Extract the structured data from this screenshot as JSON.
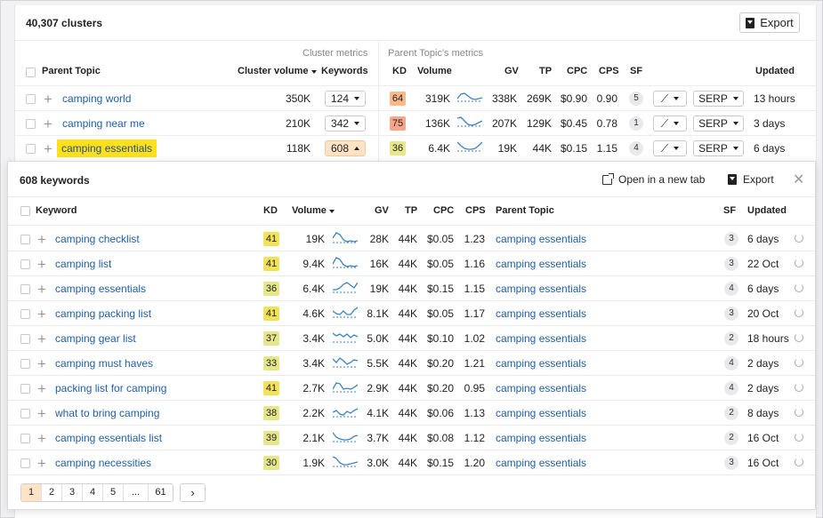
{
  "clusters_title": "40,307 clusters",
  "export_label": "Export",
  "cluster_metrics_label": "Cluster metrics",
  "parent_metrics_label": "Parent Topic's metrics",
  "outer_headers": {
    "parent_topic": "Parent Topic",
    "cluster_volume": "Cluster volume",
    "keywords": "Keywords",
    "kd": "KD",
    "volume": "Volume",
    "gv": "GV",
    "tp": "TP",
    "cpc": "CPC",
    "cps": "CPS",
    "sf": "SF",
    "updated": "Updated"
  },
  "clusters": [
    {
      "topic": "camping world",
      "cluster_volume": "350K",
      "keywords": "124",
      "kd": "64",
      "kd_color": "#f9b98a",
      "volume": "319K",
      "gv": "338K",
      "tp": "269K",
      "cpc": "$0.90",
      "cps": "0.90",
      "sf": "5",
      "serp": "SERP",
      "updated": "13 hours"
    },
    {
      "topic": "camping near me",
      "cluster_volume": "210K",
      "keywords": "342",
      "kd": "75",
      "kd_color": "#f7a68b",
      "volume": "136K",
      "gv": "207K",
      "tp": "129K",
      "cpc": "$0.45",
      "cps": "0.78",
      "sf": "1",
      "serp": "SERP",
      "updated": "3 days"
    },
    {
      "topic": "camping essentials",
      "cluster_volume": "118K",
      "keywords": "608",
      "kd": "36",
      "kd_color": "#e6e68a",
      "volume": "6.4K",
      "gv": "19K",
      "tp": "44K",
      "cpc": "$0.15",
      "cps": "1.15",
      "sf": "4",
      "serp": "SERP",
      "updated": "6 days"
    }
  ],
  "panel": {
    "title": "608 keywords",
    "open_new_tab": "Open in a new tab",
    "export": "Export",
    "headers": {
      "keyword": "Keyword",
      "kd": "KD",
      "volume": "Volume",
      "gv": "GV",
      "tp": "TP",
      "cpc": "CPC",
      "cps": "CPS",
      "parent_topic": "Parent Topic",
      "sf": "SF",
      "updated": "Updated"
    },
    "rows": [
      {
        "keyword": "camping checklist",
        "kd": "41",
        "kd_color": "#f2e25a",
        "volume": "19K",
        "gv": "28K",
        "tp": "44K",
        "cpc": "$0.05",
        "cps": "1.23",
        "parent": "camping essentials",
        "sf": "3",
        "updated": "6 days"
      },
      {
        "keyword": "camping list",
        "kd": "41",
        "kd_color": "#f2e25a",
        "volume": "9.4K",
        "gv": "16K",
        "tp": "44K",
        "cpc": "$0.05",
        "cps": "1.16",
        "parent": "camping essentials",
        "sf": "3",
        "updated": "22 Oct"
      },
      {
        "keyword": "camping essentials",
        "kd": "36",
        "kd_color": "#e6e68a",
        "volume": "6.4K",
        "gv": "19K",
        "tp": "44K",
        "cpc": "$0.15",
        "cps": "1.15",
        "parent": "camping essentials",
        "sf": "4",
        "updated": "6 days"
      },
      {
        "keyword": "camping packing list",
        "kd": "41",
        "kd_color": "#f2e25a",
        "volume": "4.6K",
        "gv": "8.1K",
        "tp": "44K",
        "cpc": "$0.05",
        "cps": "1.17",
        "parent": "camping essentials",
        "sf": "3",
        "updated": "20 Oct"
      },
      {
        "keyword": "camping gear list",
        "kd": "37",
        "kd_color": "#e6e68a",
        "volume": "3.4K",
        "gv": "5.0K",
        "tp": "44K",
        "cpc": "$0.10",
        "cps": "1.02",
        "parent": "camping essentials",
        "sf": "2",
        "updated": "18 hours"
      },
      {
        "keyword": "camping must haves",
        "kd": "33",
        "kd_color": "#e6e68a",
        "volume": "3.4K",
        "gv": "5.5K",
        "tp": "44K",
        "cpc": "$0.20",
        "cps": "1.21",
        "parent": "camping essentials",
        "sf": "4",
        "updated": "2 days"
      },
      {
        "keyword": "packing list for camping",
        "kd": "41",
        "kd_color": "#f2e25a",
        "volume": "2.7K",
        "gv": "2.9K",
        "tp": "44K",
        "cpc": "$0.20",
        "cps": "0.95",
        "parent": "camping essentials",
        "sf": "4",
        "updated": "2 days"
      },
      {
        "keyword": "what to bring camping",
        "kd": "38",
        "kd_color": "#e6e68a",
        "volume": "2.2K",
        "gv": "4.1K",
        "tp": "44K",
        "cpc": "$0.06",
        "cps": "1.13",
        "parent": "camping essentials",
        "sf": "2",
        "updated": "8 days"
      },
      {
        "keyword": "camping essentials list",
        "kd": "39",
        "kd_color": "#e6e68a",
        "volume": "2.1K",
        "gv": "3.7K",
        "tp": "44K",
        "cpc": "$0.08",
        "cps": "1.12",
        "parent": "camping essentials",
        "sf": "2",
        "updated": "16 Oct"
      },
      {
        "keyword": "camping necessities",
        "kd": "30",
        "kd_color": "#e6e68a",
        "volume": "1.9K",
        "gv": "3.0K",
        "tp": "44K",
        "cpc": "$0.15",
        "cps": "1.20",
        "parent": "camping essentials",
        "sf": "3",
        "updated": "16 Oct"
      }
    ],
    "pages": [
      "1",
      "2",
      "3",
      "4",
      "5",
      "...",
      "61"
    ],
    "next_label": "›"
  },
  "colors": {
    "link": "#1f5fa8",
    "highlight": "#ffe01b",
    "active_page": "#ffe3c7",
    "sparkline": "#3b82c4"
  }
}
